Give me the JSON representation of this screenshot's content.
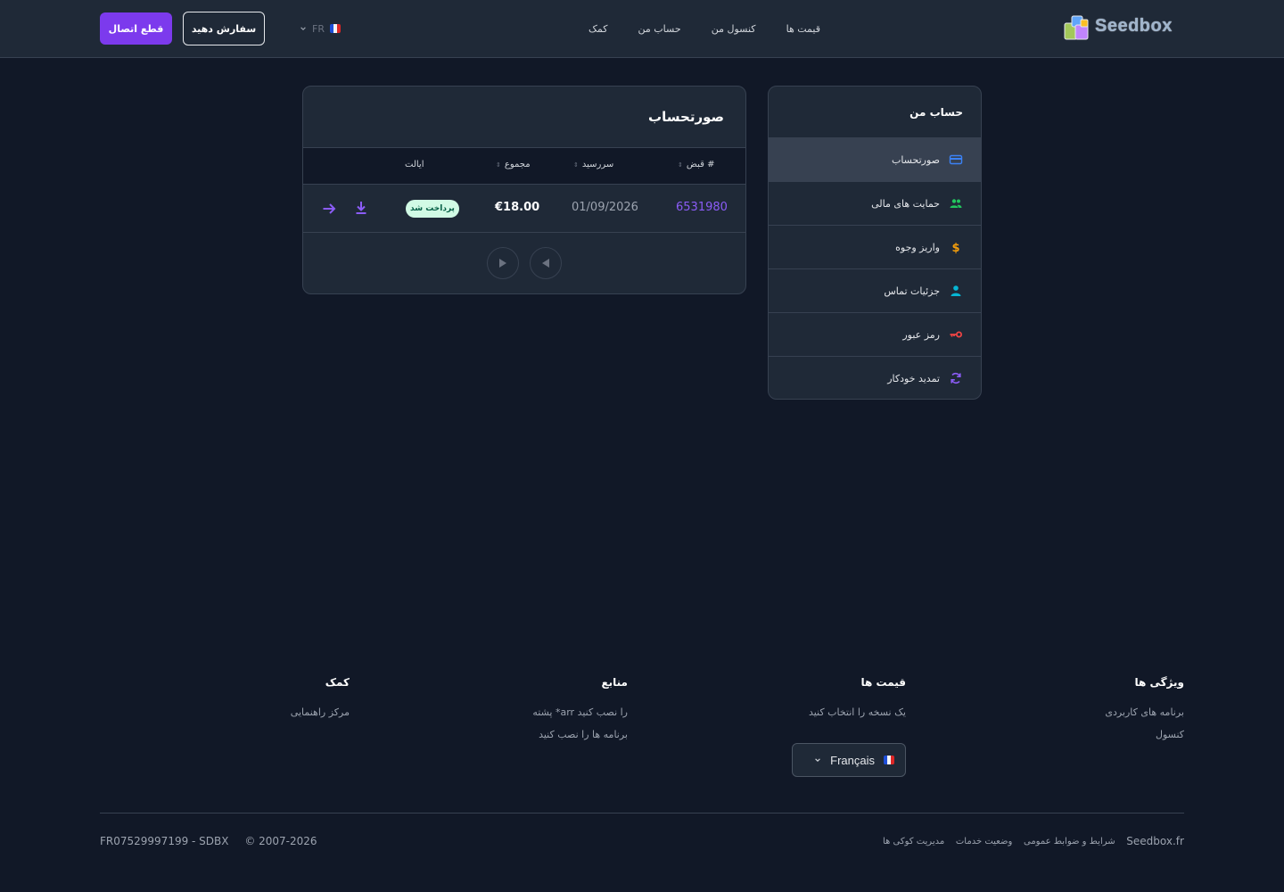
{
  "header": {
    "logo_text": "Seedbox",
    "nav": [
      "قیمت ها",
      "کنسول من",
      "حساب من",
      "کمک"
    ],
    "language": "FR",
    "order_label": "سفارش دهید",
    "logout_label": "قطع اتصال"
  },
  "sidebar": {
    "title": "حساب من",
    "items": [
      {
        "label": "صورتحساب",
        "icon": "credit-card-icon",
        "color": "#3b82f6",
        "active": true
      },
      {
        "label": "حمایت های مالی",
        "icon": "users-icon",
        "color": "#22c55e"
      },
      {
        "label": "واریز وجوه",
        "icon": "dollar-icon",
        "color": "#f59e0b"
      },
      {
        "label": "جزئیات تماس",
        "icon": "user-icon",
        "color": "#06b6d4"
      },
      {
        "label": "رمز عبور",
        "icon": "key-icon",
        "color": "#ef4444"
      },
      {
        "label": "تمدید خودکار",
        "icon": "refresh-icon",
        "color": "#8b5cf6"
      }
    ]
  },
  "invoices": {
    "title": "صورتحساب",
    "columns": [
      "قبض #",
      "سررسید",
      "مجموع",
      "ایالت"
    ],
    "rows": [
      {
        "number": "6531980",
        "due": "01/09/2026",
        "total": "€18.00",
        "status": "پرداخت شد"
      }
    ]
  },
  "footer": {
    "columns": [
      {
        "title": "ویژگی ها",
        "links": [
          "برنامه های کاربردی",
          "کنسول"
        ]
      },
      {
        "title": "قیمت ها",
        "links": [
          "یک نسخه را انتخاب کنید"
        ]
      },
      {
        "title": "منابع",
        "links": [
          "پشته *arr را نصب کنید",
          "برنامه ها را نصب کنید"
        ]
      },
      {
        "title": "کمک",
        "links": [
          "مرکز راهنمایی"
        ]
      }
    ],
    "language": "Français",
    "bottom_links": [
      "Seedbox.fr",
      "شرایط و ضوابط عمومی",
      "وضعیت خدمات",
      "مدیریت کوکی ها"
    ],
    "copyright": "© 2007-2026",
    "company": "FR07529997199 - SDBX"
  },
  "colors": {
    "accent": "#7c3aed",
    "background": "#111827",
    "surface": "#1f2937",
    "border": "#374151",
    "paid_badge_bg": "#d1fae5"
  }
}
